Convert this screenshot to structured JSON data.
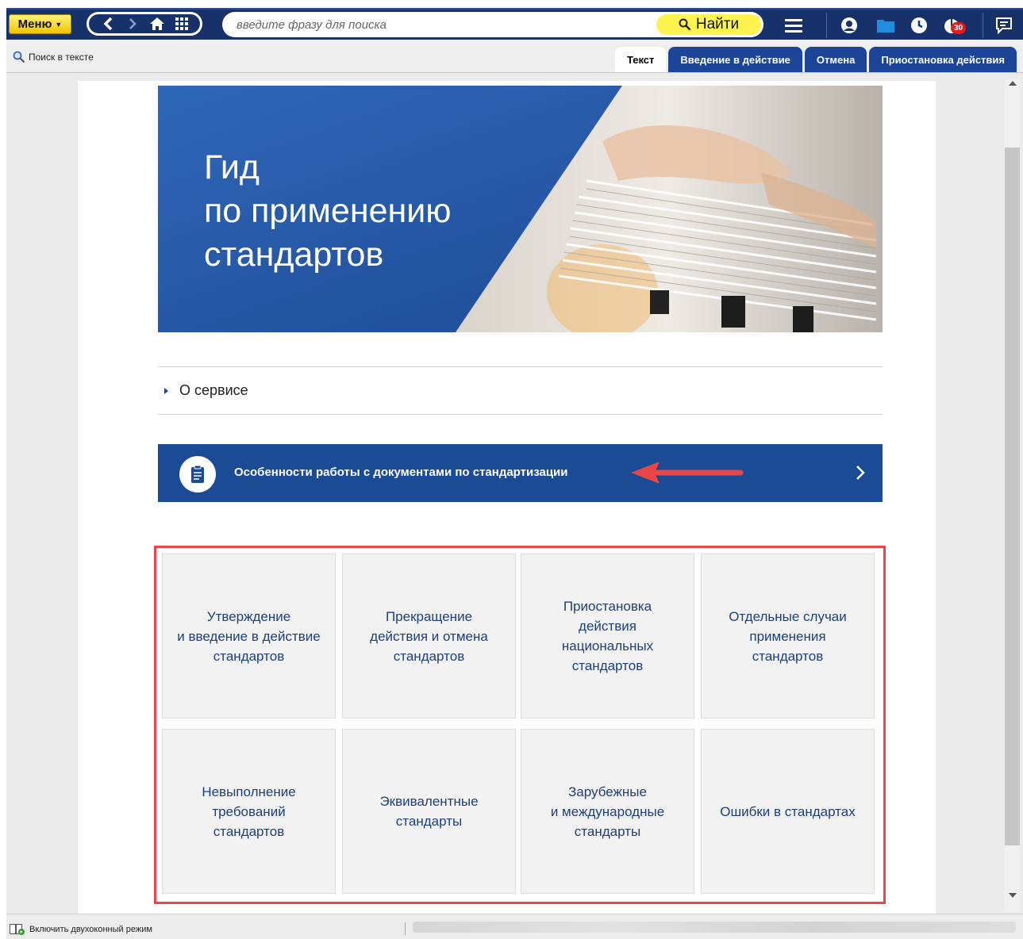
{
  "toolbar": {
    "menu_label": "Меню",
    "search_placeholder": "введите фразу для поиска",
    "find_label": "Найти",
    "notification_count": "30"
  },
  "subbar": {
    "search_in_text": "Поиск в тексте",
    "tabs": [
      {
        "label": "Текст",
        "active": true
      },
      {
        "label": "Введение в действие",
        "active": false
      },
      {
        "label": "Отмена",
        "active": false
      },
      {
        "label": "Приостановка действия",
        "active": false
      }
    ]
  },
  "hero": {
    "title_line1": "Гид",
    "title_line2": "по применению",
    "title_line3": "стандартов"
  },
  "about": {
    "label": "О сервисе"
  },
  "banner": {
    "label": "Особенности работы с документами по стандартизации"
  },
  "tiles": [
    {
      "lines": [
        "Утверждение",
        "и введение в действие",
        "стандартов"
      ]
    },
    {
      "lines": [
        "Прекращение",
        "действия и отмена",
        "стандартов"
      ]
    },
    {
      "lines": [
        "Приостановка",
        "действия",
        "национальных",
        "стандартов"
      ]
    },
    {
      "lines": [
        "Отдельные случаи",
        "применения",
        "стандартов"
      ]
    },
    {
      "lines": [
        "Невыполнение",
        "требований",
        "стандартов"
      ]
    },
    {
      "lines": [
        "Эквивалентные",
        "стандарты"
      ]
    },
    {
      "lines": [
        "Зарубежные",
        "и международные",
        "стандарты"
      ]
    },
    {
      "lines": [
        "Ошибки в стандартах"
      ]
    }
  ],
  "statusbar": {
    "two_pane_label": "Включить двухоконный режим"
  },
  "colors": {
    "toolbar_bg": "#17316a",
    "tab_blue": "#1c4597",
    "banner_blue": "#1a4b94",
    "highlight_red": "#e8474a",
    "find_yellow": "#fff34f"
  }
}
